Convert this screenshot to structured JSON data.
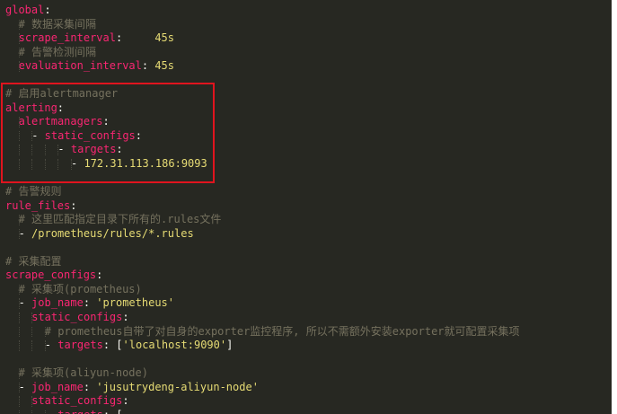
{
  "editor": {
    "lines": [
      {
        "indent": 0,
        "tokens": [
          {
            "t": "global",
            "c": "key"
          },
          {
            "t": ":",
            "c": "punc"
          }
        ]
      },
      {
        "indent": 2,
        "tokens": [
          {
            "t": "# 数据采集间隔",
            "c": "cmt"
          }
        ]
      },
      {
        "indent": 2,
        "tokens": [
          {
            "t": "scrape_interval",
            "c": "key"
          },
          {
            "t": ":     ",
            "c": "punc"
          },
          {
            "t": "45s",
            "c": "num"
          }
        ]
      },
      {
        "indent": 2,
        "tokens": [
          {
            "t": "# 告警检测间隔",
            "c": "cmt"
          }
        ]
      },
      {
        "indent": 2,
        "tokens": [
          {
            "t": "evaluation_interval",
            "c": "key"
          },
          {
            "t": ": ",
            "c": "punc"
          },
          {
            "t": "45s",
            "c": "num"
          }
        ]
      },
      {
        "indent": 0,
        "tokens": []
      },
      {
        "indent": 0,
        "tokens": [
          {
            "t": "# 启用alertmanager",
            "c": "cmt"
          }
        ]
      },
      {
        "indent": 0,
        "tokens": [
          {
            "t": "alerting",
            "c": "key"
          },
          {
            "t": ":",
            "c": "punc"
          }
        ]
      },
      {
        "indent": 2,
        "tokens": [
          {
            "t": "alertmanagers",
            "c": "key"
          },
          {
            "t": ":",
            "c": "punc"
          }
        ]
      },
      {
        "indent": 4,
        "tokens": [
          {
            "t": "- ",
            "c": "dash"
          },
          {
            "t": "static_configs",
            "c": "key"
          },
          {
            "t": ":",
            "c": "punc"
          }
        ]
      },
      {
        "indent": 8,
        "tokens": [
          {
            "t": "- ",
            "c": "dash"
          },
          {
            "t": "targets",
            "c": "key"
          },
          {
            "t": ":",
            "c": "punc"
          }
        ]
      },
      {
        "indent": 10,
        "tokens": [
          {
            "t": "- ",
            "c": "dash"
          },
          {
            "t": "172.31.113.186:9093",
            "c": "num"
          }
        ]
      },
      {
        "indent": 0,
        "tokens": []
      },
      {
        "indent": 0,
        "tokens": [
          {
            "t": "# 告警规则",
            "c": "cmt"
          }
        ]
      },
      {
        "indent": 0,
        "tokens": [
          {
            "t": "rule_files",
            "c": "key"
          },
          {
            "t": ":",
            "c": "punc"
          }
        ]
      },
      {
        "indent": 2,
        "tokens": [
          {
            "t": "# 这里匹配指定目录下所有的.rules文件",
            "c": "cmt"
          }
        ]
      },
      {
        "indent": 2,
        "tokens": [
          {
            "t": "- ",
            "c": "dash"
          },
          {
            "t": "/prometheus/rules/*.rules",
            "c": "str"
          }
        ]
      },
      {
        "indent": 0,
        "tokens": []
      },
      {
        "indent": 0,
        "tokens": [
          {
            "t": "# 采集配置",
            "c": "cmt"
          }
        ]
      },
      {
        "indent": 0,
        "tokens": [
          {
            "t": "scrape_configs",
            "c": "key"
          },
          {
            "t": ":",
            "c": "punc"
          }
        ]
      },
      {
        "indent": 2,
        "tokens": [
          {
            "t": "# 采集项(prometheus)",
            "c": "cmt"
          }
        ]
      },
      {
        "indent": 2,
        "tokens": [
          {
            "t": "- ",
            "c": "dash"
          },
          {
            "t": "job_name",
            "c": "key"
          },
          {
            "t": ": ",
            "c": "punc"
          },
          {
            "t": "'prometheus'",
            "c": "str"
          }
        ]
      },
      {
        "indent": 4,
        "tokens": [
          {
            "t": "static_configs",
            "c": "key"
          },
          {
            "t": ":",
            "c": "punc"
          }
        ]
      },
      {
        "indent": 6,
        "tokens": [
          {
            "t": "# prometheus自带了对自身的exporter监控程序, 所以不需额外安装exporter就可配置采集项",
            "c": "cmt"
          }
        ]
      },
      {
        "indent": 6,
        "tokens": [
          {
            "t": "- ",
            "c": "dash"
          },
          {
            "t": "targets",
            "c": "key"
          },
          {
            "t": ": [",
            "c": "punc"
          },
          {
            "t": "'localhost:9090'",
            "c": "str"
          },
          {
            "t": "]",
            "c": "punc"
          }
        ]
      },
      {
        "indent": 0,
        "tokens": []
      },
      {
        "indent": 2,
        "tokens": [
          {
            "t": "# 采集项(aliyun-node)",
            "c": "cmt"
          }
        ]
      },
      {
        "indent": 2,
        "tokens": [
          {
            "t": "- ",
            "c": "dash"
          },
          {
            "t": "job_name",
            "c": "key"
          },
          {
            "t": ": ",
            "c": "punc"
          },
          {
            "t": "'jusutrydeng-aliyun-node'",
            "c": "str"
          }
        ]
      },
      {
        "indent": 4,
        "tokens": [
          {
            "t": "static_configs",
            "c": "key"
          },
          {
            "t": ":",
            "c": "punc"
          }
        ]
      },
      {
        "indent": 6,
        "tokens": [
          {
            "t": "- ",
            "c": "dash"
          },
          {
            "t": "targets",
            "c": "key"
          },
          {
            "t": ": [",
            "c": "punc"
          }
        ]
      }
    ]
  },
  "colors": {
    "background": "#272822",
    "key": "#f92672",
    "comment": "#75715e",
    "string": "#e6db74",
    "plain": "#f8f8f2",
    "highlight_box": "#e0141e"
  }
}
